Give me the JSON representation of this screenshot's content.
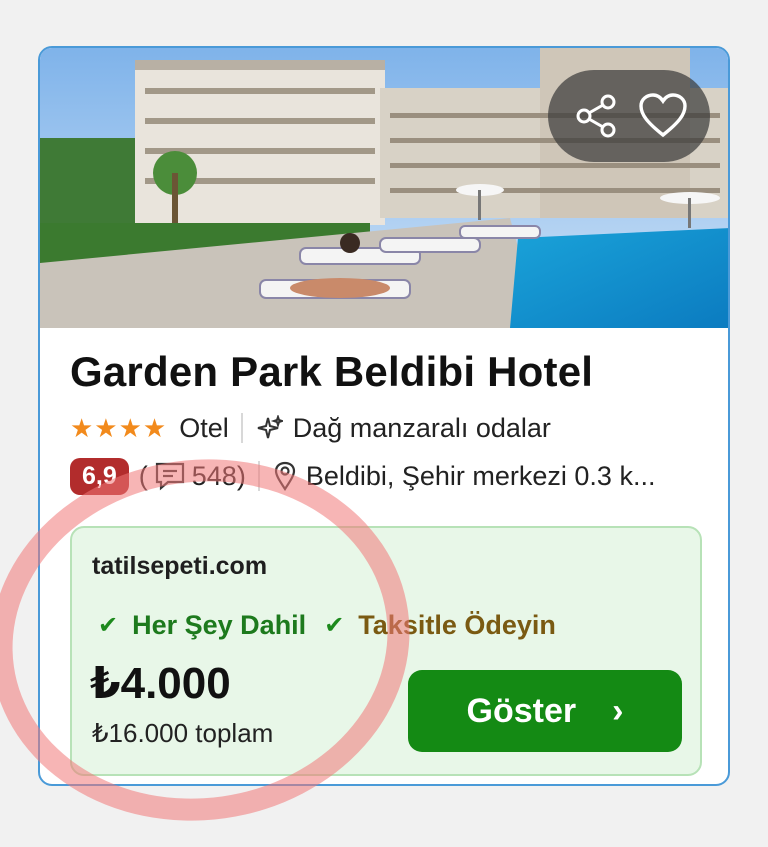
{
  "hotel": {
    "name": "Garden Park Beldibi Hotel",
    "stars": "★★★★",
    "type": "Otel",
    "feature": "Dağ manzaralı odalar",
    "score": "6,9",
    "reviews_open": "(",
    "reviews_count": "548)",
    "location": "Beldibi, Şehir merkezi 0.3 k..."
  },
  "offer": {
    "site": "tatilsepeti.com",
    "features": [
      "Her Şey Dahil",
      "Taksitle Ödeyin"
    ],
    "price": "₺4.000",
    "total": "₺16.000 toplam",
    "button_label": "Göster",
    "button_chevron": "›"
  },
  "icons": {
    "share": "share-icon",
    "heart": "heart-icon",
    "sparkle": "sparkle-icon",
    "comment": "comment-icon",
    "pin": "map-pin-icon",
    "check": "check-icon"
  },
  "colors": {
    "accent_green": "#148a14",
    "score_red": "#b22c2c",
    "star_orange": "#f28a1c",
    "feature_green": "#1d7a1d",
    "feature_brown": "#7a5a12"
  }
}
